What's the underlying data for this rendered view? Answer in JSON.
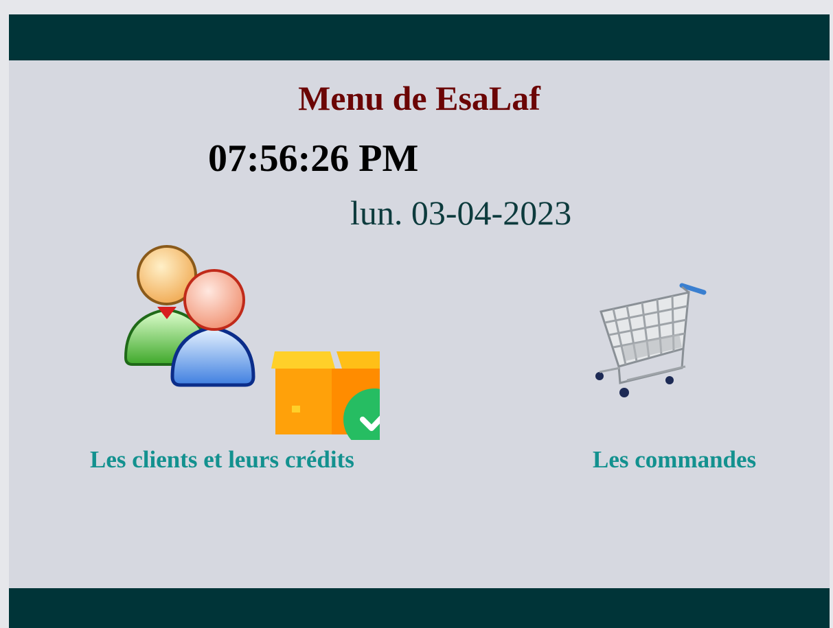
{
  "page": {
    "title": "Menu de EsaLaf",
    "time": "07:56:26 PM",
    "date": "lun. 03-04-2023"
  },
  "menu": {
    "items": [
      {
        "label": "Les clients et leurs crédits",
        "icon": "clients-credits-icon"
      },
      {
        "label": "Les commandes",
        "icon": "shopping-cart-icon"
      }
    ]
  },
  "colors": {
    "bar": "#003438",
    "background": "#d6d8e0",
    "title": "#6b0505",
    "clock": "#000000",
    "date": "#0d3b3d",
    "label": "#13918f"
  }
}
